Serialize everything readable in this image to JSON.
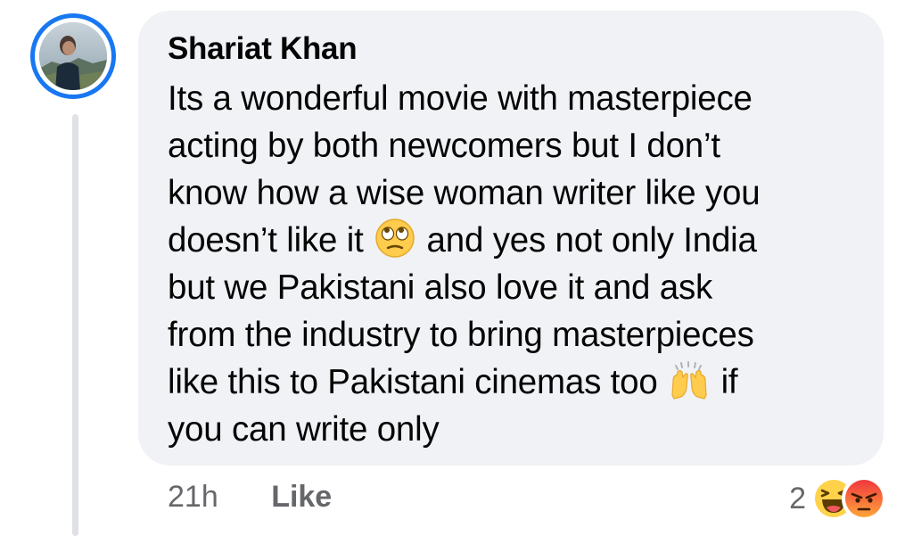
{
  "comment": {
    "author": "Shariat Khan",
    "lines": [
      {
        "before": "Its a wonderful movie with masterpiece"
      },
      {
        "before": "acting by both newcomers but I don’t"
      },
      {
        "before": "know how a wise woman writer like you"
      },
      {
        "before": "doesn’t like it ",
        "emoji": "face-with-rolling-eyes-icon",
        "after": " and yes not only India"
      },
      {
        "before": "but we Pakistani also love it and ask"
      },
      {
        "before": "from the industry to bring masterpieces"
      },
      {
        "before": "like this to Pakistani cinemas too ",
        "emoji": "raising-hands-icon",
        "after": " if"
      },
      {
        "before": "you can write only"
      }
    ],
    "timestamp": "21h",
    "like_label": "Like",
    "reaction_count": "2",
    "reaction_icons": [
      "haha-reaction-icon",
      "angry-reaction-icon"
    ]
  },
  "colors": {
    "accent": "#1877f2",
    "bubble": "#f0f2f5",
    "text": "#050505",
    "meta_text": "#65676b",
    "thread_line": "#dfe1e5"
  }
}
